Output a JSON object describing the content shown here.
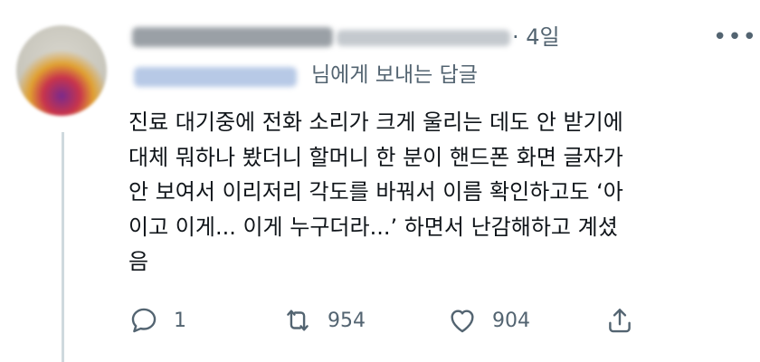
{
  "tweet": {
    "time_meta": "· 4일",
    "more_glyph": "•••",
    "reply_to_suffix": "님에게 보내는 답글",
    "text_lines": [
      "진료 대기중에 전화 소리가 크게 울리는 데도 안 받기에",
      "대체 뭐하나 봤더니 할머니 한 분이 핸드폰 화면 글자가",
      "안 보여서 이리저리 각도를 바꿔서 이름 확인하고도 ‘아",
      "이고 이게... 이게 누구더라...’ 하면서 난감해하고 계셨",
      "음"
    ]
  },
  "actions": {
    "reply_count": "1",
    "retweet_count": "954",
    "like_count": "904"
  },
  "icons": {
    "reply": "reply-icon",
    "retweet": "retweet-icon",
    "like": "heart-icon",
    "share": "share-icon",
    "more": "more-icon"
  },
  "colors": {
    "text": "#0f1419",
    "secondary": "#536471",
    "thread_line": "#cfd9de"
  }
}
